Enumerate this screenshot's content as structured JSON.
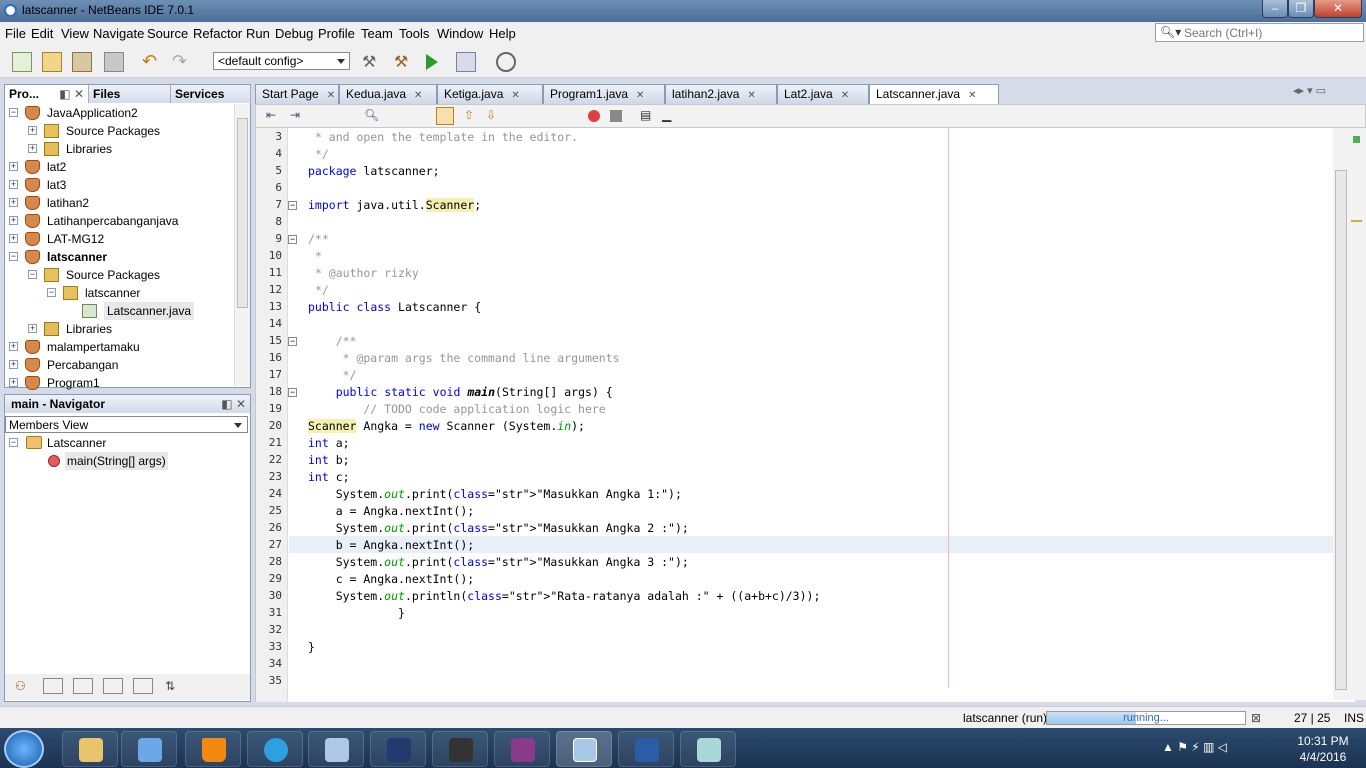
{
  "window": {
    "title": "latscanner - NetBeans IDE 7.0.1"
  },
  "menu": [
    "File",
    "Edit",
    "View",
    "Navigate",
    "Source",
    "Refactor",
    "Run",
    "Debug",
    "Profile",
    "Team",
    "Tools",
    "Window",
    "Help"
  ],
  "search": {
    "placeholder": "Search (Ctrl+I)"
  },
  "toolbar": {
    "config": "<default config>"
  },
  "panel_tabs": [
    "Pro...",
    "Files",
    "Services"
  ],
  "projects": [
    {
      "label": "JavaApplication2",
      "level": 0,
      "icon": "project-icon",
      "exp": "−"
    },
    {
      "label": "Source Packages",
      "level": 1,
      "icon": "package-folder-icon",
      "exp": "+"
    },
    {
      "label": "Libraries",
      "level": 1,
      "icon": "libraries-icon",
      "exp": "+"
    },
    {
      "label": "lat2",
      "level": 0,
      "icon": "project-icon",
      "exp": "+"
    },
    {
      "label": "lat3",
      "level": 0,
      "icon": "project-icon",
      "exp": "+"
    },
    {
      "label": "latihan2",
      "level": 0,
      "icon": "project-icon",
      "exp": "+"
    },
    {
      "label": "Latihanpercabanganjava",
      "level": 0,
      "icon": "project-icon",
      "exp": "+"
    },
    {
      "label": "LAT-MG12",
      "level": 0,
      "icon": "project-icon",
      "exp": "+"
    },
    {
      "label": "latscanner",
      "level": 0,
      "icon": "project-icon",
      "exp": "−",
      "bold": true
    },
    {
      "label": "Source Packages",
      "level": 1,
      "icon": "package-folder-icon",
      "exp": "−"
    },
    {
      "label": "latscanner",
      "level": 2,
      "icon": "package-icon",
      "exp": "−"
    },
    {
      "label": "Latscanner.java",
      "level": 3,
      "icon": "java-file-icon",
      "exp": "",
      "selected": true
    },
    {
      "label": "Libraries",
      "level": 1,
      "icon": "libraries-icon",
      "exp": "+"
    },
    {
      "label": "malampertamaku",
      "level": 0,
      "icon": "project-icon",
      "exp": "+"
    },
    {
      "label": "Percabangan",
      "level": 0,
      "icon": "project-icon",
      "exp": "+"
    },
    {
      "label": "Program1",
      "level": 0,
      "icon": "project-icon",
      "exp": "+"
    }
  ],
  "navigator": {
    "title": "main - Navigator",
    "view": "Members View",
    "class_name": "Latscanner",
    "method": "main(String[] args)"
  },
  "editor_tabs": [
    "Start Page",
    "Kedua.java",
    "Ketiga.java",
    "Program1.java",
    "latihan2.java",
    "Lat2.java",
    "Latscanner.java"
  ],
  "code_lines": [
    {
      "n": "3",
      "t": " * and open the template in the editor."
    },
    {
      "n": "4",
      "t": " */"
    },
    {
      "n": "5",
      "t": "package latscanner;"
    },
    {
      "n": "6",
      "t": ""
    },
    {
      "n": "7",
      "t": "import java.util.Scanner;"
    },
    {
      "n": "8",
      "t": ""
    },
    {
      "n": "9",
      "t": "/**"
    },
    {
      "n": "10",
      "t": " *"
    },
    {
      "n": "11",
      "t": " * @author rizky"
    },
    {
      "n": "12",
      "t": " */"
    },
    {
      "n": "13",
      "t": "public class Latscanner {"
    },
    {
      "n": "14",
      "t": ""
    },
    {
      "n": "15",
      "t": "    /**"
    },
    {
      "n": "16",
      "t": "     * @param args the command line arguments"
    },
    {
      "n": "17",
      "t": "     */"
    },
    {
      "n": "18",
      "t": "    public static void main(String[] args) {"
    },
    {
      "n": "19",
      "t": "        // TODO code application logic here"
    },
    {
      "n": "20",
      "t": "Scanner Angka = new Scanner (System.in);"
    },
    {
      "n": "21",
      "t": "int a;"
    },
    {
      "n": "22",
      "t": "int b;"
    },
    {
      "n": "23",
      "t": "int c;"
    },
    {
      "n": "24",
      "t": "    System.out.print(\"Masukkan Angka 1:\");"
    },
    {
      "n": "25",
      "t": "    a = Angka.nextInt();"
    },
    {
      "n": "26",
      "t": "    System.out.print(\"Masukkan Angka 2 :\");"
    },
    {
      "n": "27",
      "t": "    b = Angka.nextInt();"
    },
    {
      "n": "28",
      "t": "    System.out.print(\"Masukkan Angka 3 :\");"
    },
    {
      "n": "29",
      "t": "    c = Angka.nextInt();"
    },
    {
      "n": "30",
      "t": "    System.out.println(\"Rata-ratanya adalah :\" + ((a+b+c)/3));"
    },
    {
      "n": "31",
      "t": "             }"
    },
    {
      "n": "32",
      "t": ""
    },
    {
      "n": "33",
      "t": "}"
    },
    {
      "n": "34",
      "t": ""
    },
    {
      "n": "35",
      "t": ""
    }
  ],
  "status": {
    "run_label": "latscanner (run)",
    "progress_text": "running...",
    "position": "27 | 25",
    "mode": "INS",
    "progress": 0.45
  },
  "clock": {
    "time": "10:31 PM",
    "date": "4/4/2016"
  },
  "colors": {
    "string": "#ce7b00",
    "keyword": "#0000e6",
    "comment": "#969696",
    "selection": "#e9eff8"
  }
}
